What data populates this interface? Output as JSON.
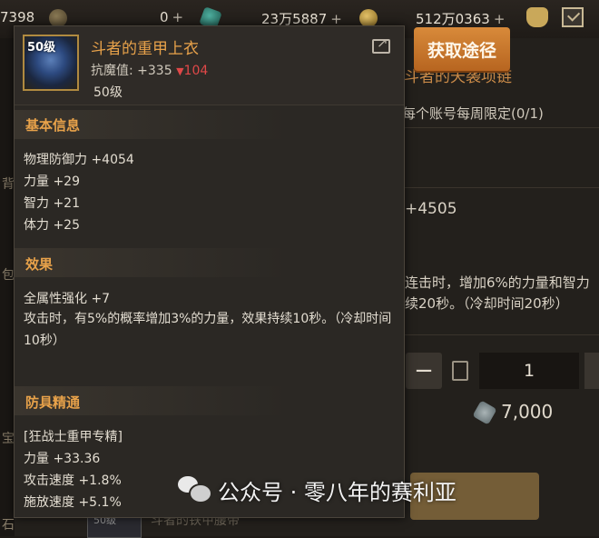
{
  "topbar": {
    "resource1": "7398",
    "resource2": "0",
    "resource3": "23万5887",
    "resource4": "512万0363",
    "plus": "+"
  },
  "background": {
    "obtain_button": "获取途径",
    "equip_title": "斗者的天袭项链",
    "limit_text": "每个账号每周限定(0/1)",
    "stat_text": "+4505",
    "desc_line1": "连击时，增加6%的力量和智力",
    "desc_line2": "续20秒。（冷却时间20秒）",
    "quantity": "1",
    "price": "7,000",
    "bottom_item_level": "50级",
    "bottom_item_text": "斗者的铁甲腰带",
    "left_strip": [
      "背",
      "包",
      "宝",
      "石"
    ]
  },
  "tooltip": {
    "level_badge": "50级",
    "item_name": "斗者的重甲上衣",
    "resist_label": "抗魔值:",
    "resist_value": "+335",
    "resist_down": "104",
    "level_text": "50级",
    "basic_info": {
      "title": "基本信息",
      "lines": [
        "物理防御力 +4054",
        "力量 +29",
        "智力 +21",
        "体力 +25"
      ]
    },
    "effect": {
      "title": "效果",
      "lines": [
        "全属性强化 +7",
        "攻击时，有5%的概率增加3%的力量，效果持续10秒。（冷却时间10秒）"
      ]
    },
    "mastery": {
      "title": "防具精通",
      "lines": [
        "[狂战士重甲专精]",
        "力量 +33.36",
        "攻击速度 +1.8%",
        "施放速度 +5.1%"
      ]
    }
  },
  "watermark": {
    "text": "公众号 · 零八年的赛利亚"
  },
  "colors": {
    "accent_orange": "#e8a24a",
    "button_orange": "#c97a2e",
    "stat_down_red": "#e04848",
    "panel_bg": "#2b2824"
  }
}
